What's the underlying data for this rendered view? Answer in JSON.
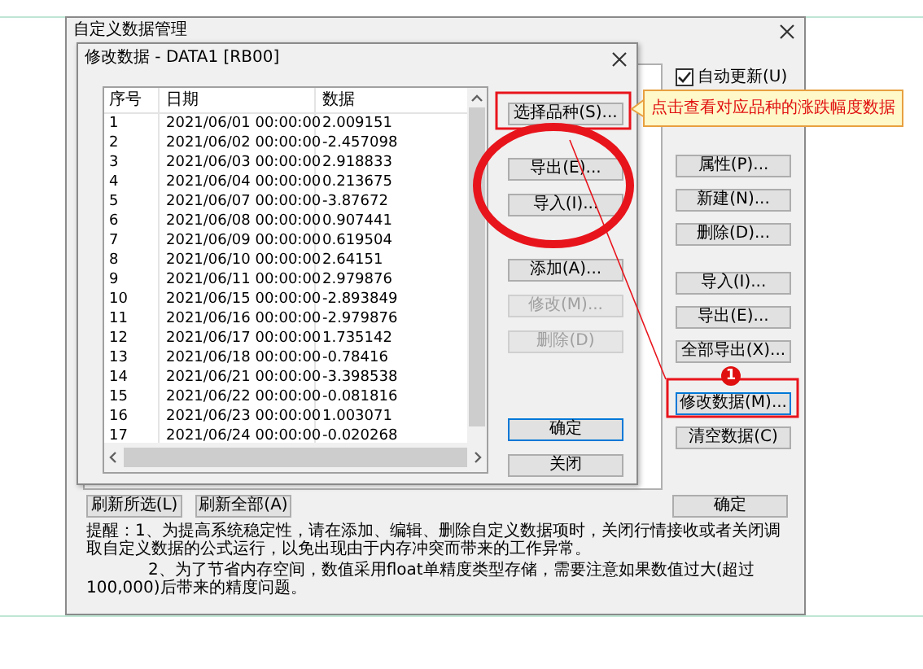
{
  "outer_window": {
    "title": "自定义数据管理"
  },
  "auto_update": {
    "label": "自动更新(U)",
    "checked": true
  },
  "outer_button_groups": [
    [
      {
        "label": "属性(P)...",
        "focused": false
      },
      {
        "label": "新建(N)...",
        "focused": false
      },
      {
        "label": "删除(D)...",
        "focused": false
      }
    ],
    [
      {
        "label": "导入(I)...",
        "focused": false
      },
      {
        "label": "导出(E)...",
        "focused": false
      },
      {
        "label": "全部导出(X)...",
        "focused": false
      }
    ],
    [
      {
        "label": "修改数据(M)...",
        "focused": true
      },
      {
        "label": "清空数据(C)",
        "focused": false
      }
    ]
  ],
  "refresh_buttons": [
    "刷新所选(L)",
    "刷新全部(A)"
  ],
  "outer_ok": "确定",
  "notes": [
    "提醒：1、为提高系统稳定性，请在添加、编辑、删除自定义数据项时，关闭行情接收或者关闭调取自定义数据的公式运行，以免出现由于内存冲突而带来的工作异常。",
    "2、为了节省内存空间，数值采用float单精度类型存储，需要注意如果数值过大(超过100,000)后带来的精度问题。"
  ],
  "inner_window": {
    "title": "修改数据 - DATA1 [RB00]"
  },
  "table": {
    "columns": [
      "序号",
      "日期",
      "数据"
    ],
    "rows": [
      [
        "1",
        "2021/06/01 00:00:00",
        "2.009151"
      ],
      [
        "2",
        "2021/06/02 00:00:00",
        "-2.457098"
      ],
      [
        "3",
        "2021/06/03 00:00:00",
        "2.918833"
      ],
      [
        "4",
        "2021/06/04 00:00:00",
        "0.213675"
      ],
      [
        "5",
        "2021/06/07 00:00:00",
        "-3.87672"
      ],
      [
        "6",
        "2021/06/08 00:00:00",
        "0.907441"
      ],
      [
        "7",
        "2021/06/09 00:00:00",
        "0.619504"
      ],
      [
        "8",
        "2021/06/10 00:00:00",
        "2.64151"
      ],
      [
        "9",
        "2021/06/11 00:00:00",
        "2.979876"
      ],
      [
        "10",
        "2021/06/15 00:00:00",
        "-2.893849"
      ],
      [
        "11",
        "2021/06/16 00:00:00",
        "-2.979876"
      ],
      [
        "12",
        "2021/06/17 00:00:00",
        "1.735142"
      ],
      [
        "13",
        "2021/06/18 00:00:00",
        "-0.78416"
      ],
      [
        "14",
        "2021/06/21 00:00:00",
        "-3.398538"
      ],
      [
        "15",
        "2021/06/22 00:00:00",
        "-0.081816"
      ],
      [
        "16",
        "2021/06/23 00:00:00",
        "1.003071"
      ],
      [
        "17",
        "2021/06/24 00:00:00",
        "-0.020268"
      ]
    ]
  },
  "inner_button_groups": [
    [
      {
        "label": "选择品种(S)...",
        "disabled": false,
        "focused": false
      }
    ],
    [
      {
        "label": "导出(E)...",
        "disabled": false,
        "focused": false
      },
      {
        "label": "导入(I)...",
        "disabled": false,
        "focused": false
      }
    ],
    [
      {
        "label": "添加(A)...",
        "disabled": false,
        "focused": false
      },
      {
        "label": "修改(M)...",
        "disabled": true,
        "focused": false
      },
      {
        "label": "删除(D)",
        "disabled": true,
        "focused": false
      }
    ],
    [
      {
        "label": "确定",
        "disabled": false,
        "focused": true
      },
      {
        "label": "关闭",
        "disabled": false,
        "focused": false
      }
    ]
  ],
  "annotation": {
    "callout": "点击查看对应品种的涨跌幅度数据",
    "badge": "1"
  }
}
